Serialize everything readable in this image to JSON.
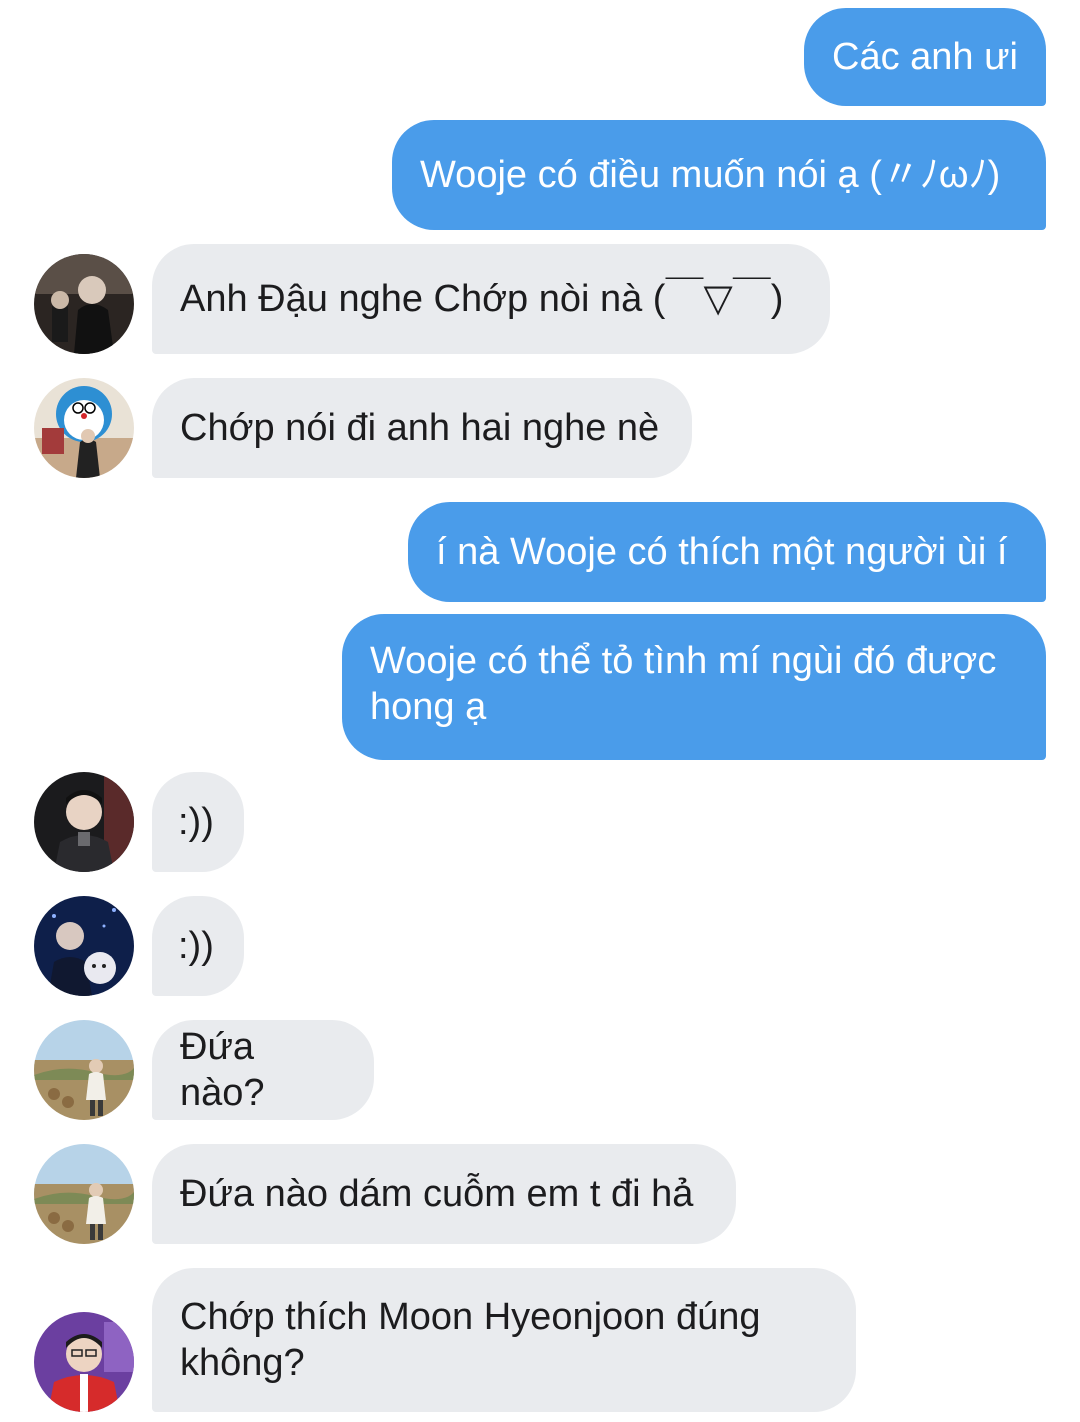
{
  "messages": [
    {
      "direction": "out",
      "text": "Các anh ưi"
    },
    {
      "direction": "out",
      "text": "Wooje có điều muốn nói ạ (〃ﾉωﾉ)"
    },
    {
      "direction": "in",
      "text": "Anh Đậu nghe Chớp nòi nà (￣▽￣)",
      "avatar": "avatar-dark-photo"
    },
    {
      "direction": "in",
      "text": "Chớp nói đi anh hai nghe nè",
      "avatar": "avatar-doraemon-photo"
    },
    {
      "direction": "out",
      "text": "í nà Wooje có thích một người ùi í"
    },
    {
      "direction": "out",
      "text": "Wooje có thể tỏ tình mí ngùi đó được hong ạ"
    },
    {
      "direction": "in",
      "text": ":))",
      "avatar": "avatar-suit-photo"
    },
    {
      "direction": "in",
      "text": ":))",
      "avatar": "avatar-blue-night-photo"
    },
    {
      "direction": "in",
      "text": "Đứa nào?",
      "avatar": "avatar-field-photo"
    },
    {
      "direction": "in",
      "text": "Đứa nào dám cuỗm em t đi hả",
      "avatar": "avatar-field-photo"
    },
    {
      "direction": "in",
      "text": "Chớp thích Moon Hyeonjoon đúng không?",
      "avatar": "avatar-red-jacket-photo"
    }
  ],
  "colors": {
    "outgoing_bubble": "#4a9cea",
    "incoming_bubble": "#e9ebee",
    "outgoing_text": "#ffffff",
    "incoming_text": "#1c1c1e"
  }
}
